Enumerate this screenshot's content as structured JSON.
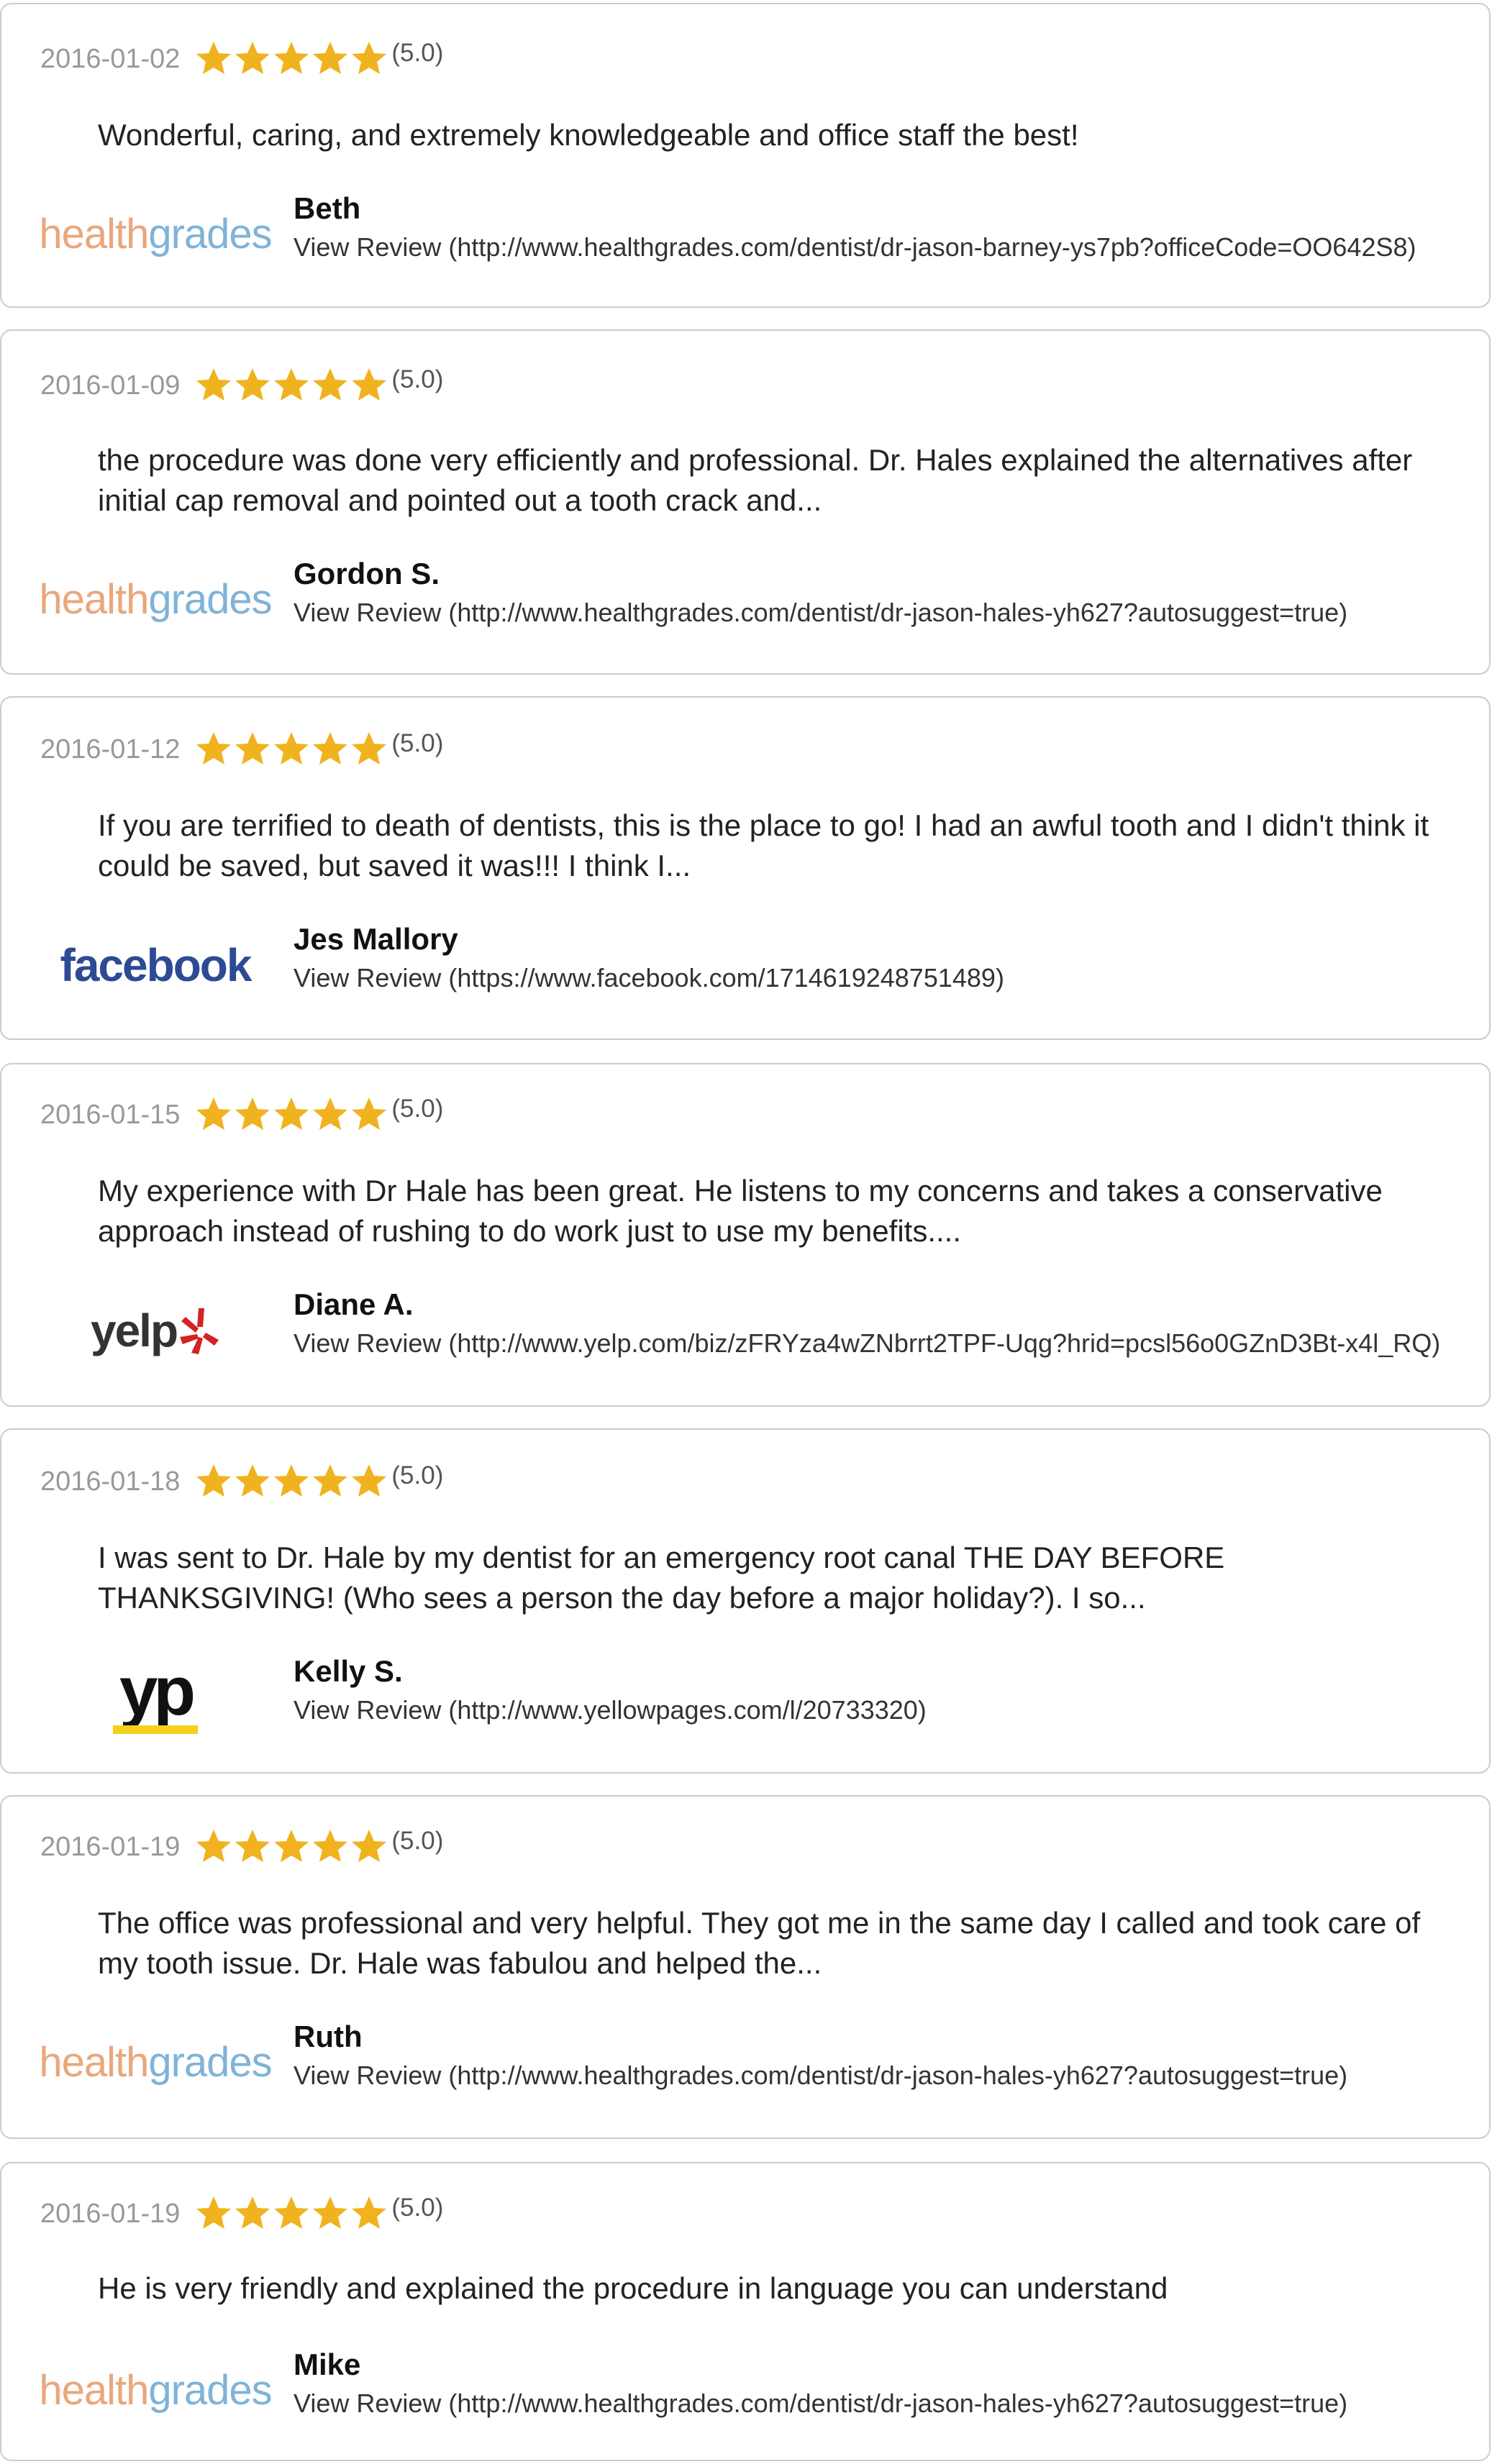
{
  "colors": {
    "star": "#f0b21e",
    "date": "#999999",
    "border": "#cccccc"
  },
  "reviews": [
    {
      "date": "2016-01-02",
      "rating": "(5.0)",
      "stars": 5,
      "text": "Wonderful, caring, and extremely knowledgeable and office staff the best!",
      "author": "Beth",
      "link": "View Review (http://www.healthgrades.com/dentist/dr-jason-barney-ys7pb?officeCode=OO642S8)",
      "source": "healthgrades",
      "source_parts": [
        "health",
        "grades"
      ]
    },
    {
      "date": "2016-01-09",
      "rating": "(5.0)",
      "stars": 5,
      "text": "the procedure was done very efficiently and professional. Dr. Hales explained the alternatives after initial cap removal and pointed out a tooth crack and...",
      "author": "Gordon S.",
      "link": "View Review (http://www.healthgrades.com/dentist/dr-jason-hales-yh627?autosuggest=true)",
      "source": "healthgrades",
      "source_parts": [
        "health",
        "grades"
      ]
    },
    {
      "date": "2016-01-12",
      "rating": "(5.0)",
      "stars": 5,
      "text": "If you are terrified to death of dentists, this is the place to go! I had an awful tooth and I didn't think it could be saved, but saved it was!!! I think I...",
      "author": "Jes Mallory",
      "link": "View Review (https://www.facebook.com/1714619248751489)",
      "source": "facebook"
    },
    {
      "date": "2016-01-15",
      "rating": "(5.0)",
      "stars": 5,
      "text": "My experience with Dr Hale has been great. He listens to my concerns and takes a conservative approach instead of rushing to do work just to use my benefits....",
      "author": "Diane A.",
      "link": "View Review (http://www.yelp.com/biz/zFRYza4wZNbrrt2TPF-Uqg?hrid=pcsl56o0GZnD3Bt-x4l_RQ)",
      "source": "yelp"
    },
    {
      "date": "2016-01-18",
      "rating": "(5.0)",
      "stars": 5,
      "text": "I was sent to Dr. Hale by my dentist for an emergency root canal THE DAY BEFORE THANKSGIVING! (Who sees a person the day before a major holiday?). I so...",
      "author": "Kelly S.",
      "link": "View Review (http://www.yellowpages.com/l/20733320)",
      "source": "yp"
    },
    {
      "date": "2016-01-19",
      "rating": "(5.0)",
      "stars": 5,
      "text": "The office was professional and very helpful. They got me in the same day I called and took care of my tooth issue. Dr. Hale was fabulou and helped the...",
      "author": "Ruth",
      "link": "View Review (http://www.healthgrades.com/dentist/dr-jason-hales-yh627?autosuggest=true)",
      "source": "healthgrades",
      "source_parts": [
        "health",
        "grades"
      ]
    },
    {
      "date": "2016-01-19",
      "rating": "(5.0)",
      "stars": 5,
      "text": "He is very friendly and explained the procedure in language you can understand",
      "author": "Mike",
      "link": "View Review (http://www.healthgrades.com/dentist/dr-jason-hales-yh627?autosuggest=true)",
      "source": "healthgrades",
      "source_parts": [
        "health",
        "grades"
      ]
    }
  ]
}
